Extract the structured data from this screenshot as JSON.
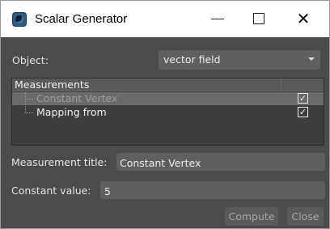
{
  "window": {
    "title": "Scalar Generator",
    "minimize_glyph": "",
    "maximize_glyph": "",
    "close_glyph": "✕"
  },
  "object": {
    "label": "Object:",
    "selected": "vector field"
  },
  "tree": {
    "header": "Measurements",
    "items": [
      {
        "label": "Constant Vertex",
        "checked": true,
        "selected": true
      },
      {
        "label": "Mapping from",
        "checked": true,
        "selected": false
      }
    ]
  },
  "measurement_title": {
    "label": "Measurement title:",
    "value": "Constant Vertex"
  },
  "constant_value": {
    "label": "Constant value:",
    "value": "5"
  },
  "buttons": {
    "compute": "Compute",
    "close": "Close"
  },
  "icons": {
    "app": "app-logo-icon",
    "check": "✓"
  },
  "colors": {
    "window_bg": "#4b4b4b",
    "field_bg": "#5f5f5f",
    "selection": "#6a6a6a"
  }
}
